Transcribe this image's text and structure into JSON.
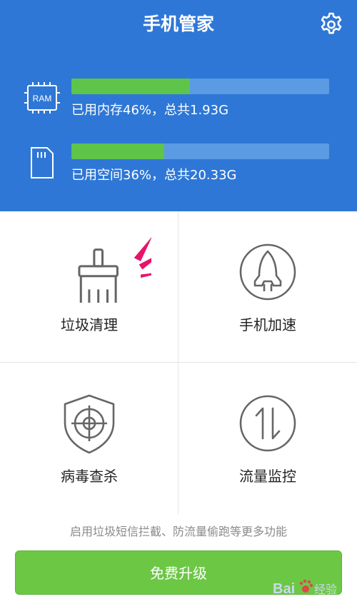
{
  "header": {
    "title": "手机管家",
    "settings_icon": "gear-icon"
  },
  "ram": {
    "chip_label": "RAM",
    "used_fraction": 0.46,
    "text": "已用内存46%，总共1.93G"
  },
  "storage": {
    "used_fraction": 0.36,
    "text": "已用空间36%，总共20.33G"
  },
  "features": [
    {
      "label": "垃圾清理",
      "icon": "broom-icon"
    },
    {
      "label": "手机加速",
      "icon": "rocket-icon"
    },
    {
      "label": "病毒查杀",
      "icon": "shield-crosshair-icon"
    },
    {
      "label": "流量监控",
      "icon": "up-down-arrows-icon"
    }
  ],
  "hint": "启用垃圾短信拦截、防流量偷跑等更多功能",
  "upgrade_label": "免费升级",
  "watermark": {
    "brand": "Bai",
    "suffix": "经验"
  },
  "colors": {
    "header_bg": "#2e77d6",
    "bar_track": "#5a9be4",
    "bar_fill": "#5ec44a",
    "button": "#6cc745",
    "accent_spark": "#e8136b"
  }
}
